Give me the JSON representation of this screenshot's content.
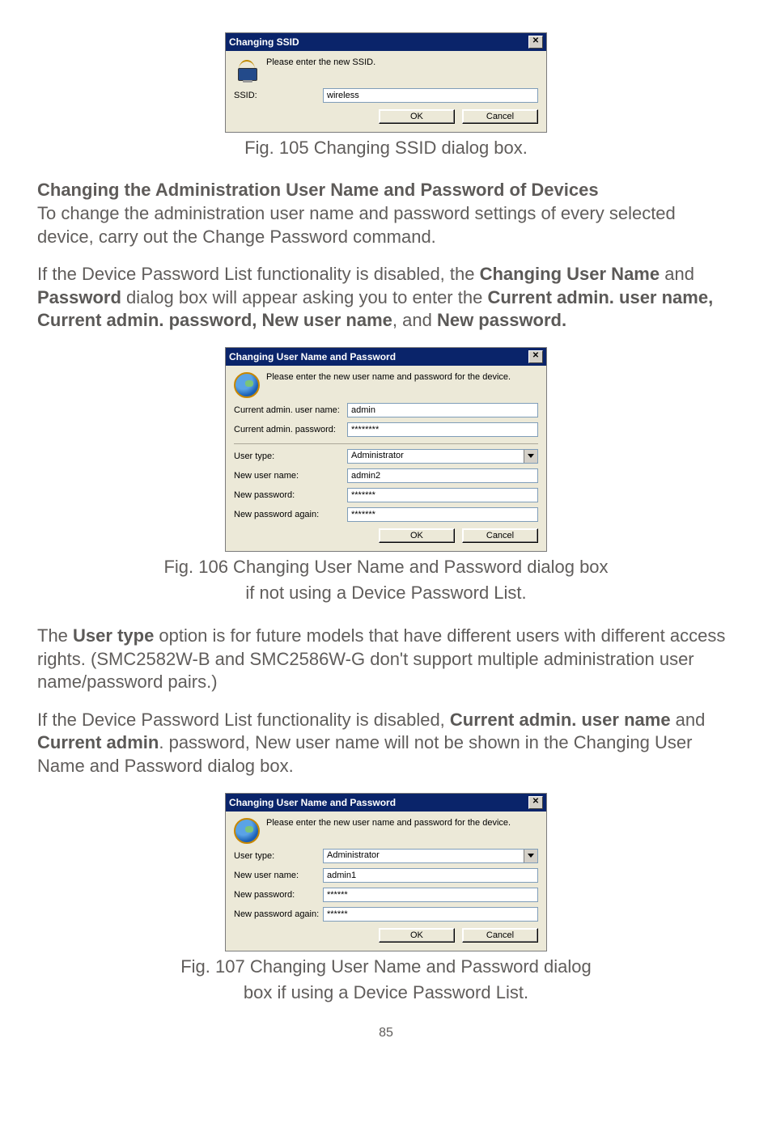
{
  "fig105": {
    "dialog": {
      "title": "Changing SSID",
      "message": "Please enter the new SSID.",
      "ssid_label": "SSID:",
      "ssid_value": "wireless",
      "ok": "OK",
      "cancel": "Cancel"
    },
    "caption": "Fig. 105 Changing SSID dialog box."
  },
  "section1": {
    "heading": "Changing the Administration User Name and Password of Devices",
    "para": "To change the administration user name and password settings of every selected device, carry out the Change Password command."
  },
  "para2_parts": {
    "a": "If the Device Password List functionality is disabled, the ",
    "b_bold": "Changing User Name",
    "c": " and ",
    "d_bold": "Password",
    "e": " dialog box will appear asking you to enter the ",
    "f_bold": "Current admin. user name, Current admin. password, New user name",
    "g": ", and ",
    "h_bold": "New password."
  },
  "fig106": {
    "dialog": {
      "title": "Changing User Name and Password",
      "message": "Please enter the new user name and password for the device.",
      "cur_user_label": "Current admin. user name:",
      "cur_user_value": "admin",
      "cur_pass_label": "Current admin. password:",
      "cur_pass_value": "********",
      "user_type_label": "User type:",
      "user_type_value": "Administrator",
      "new_user_label": "New user name:",
      "new_user_value": "admin2",
      "new_pass_label": "New password:",
      "new_pass_value": "*******",
      "new_pass2_label": "New password again:",
      "new_pass2_value": "*******",
      "ok": "OK",
      "cancel": "Cancel"
    },
    "caption_l1": "Fig. 106 Changing User Name and Password dialog box",
    "caption_l2": "if not using a Device Password List."
  },
  "para3_parts": {
    "a": "The ",
    "b_bold": "User type",
    "c": " option is for future models that have different users with different access rights. (SMC2582W-B and SMC2586W-G don't support multiple administration user name/password pairs.)"
  },
  "para4_parts": {
    "a": "If the Device Password List functionality is disabled, ",
    "b_bold": "Current admin. user name",
    "c": " and ",
    "d_bold": "Current admin",
    "e": ". password, New user name will not be shown in the Changing User Name and Password dialog box."
  },
  "fig107": {
    "dialog": {
      "title": "Changing User Name and Password",
      "message": "Please enter the new user name and password for the device.",
      "user_type_label": "User type:",
      "user_type_value": "Administrator",
      "new_user_label": "New user name:",
      "new_user_value": "admin1",
      "new_pass_label": "New password:",
      "new_pass_value": "******",
      "new_pass2_label": "New password again:",
      "new_pass2_value": "******",
      "ok": "OK",
      "cancel": "Cancel"
    },
    "caption_l1": "Fig. 107 Changing User Name and Password dialog",
    "caption_l2": "box if using a Device Password List."
  },
  "page_number": "85"
}
